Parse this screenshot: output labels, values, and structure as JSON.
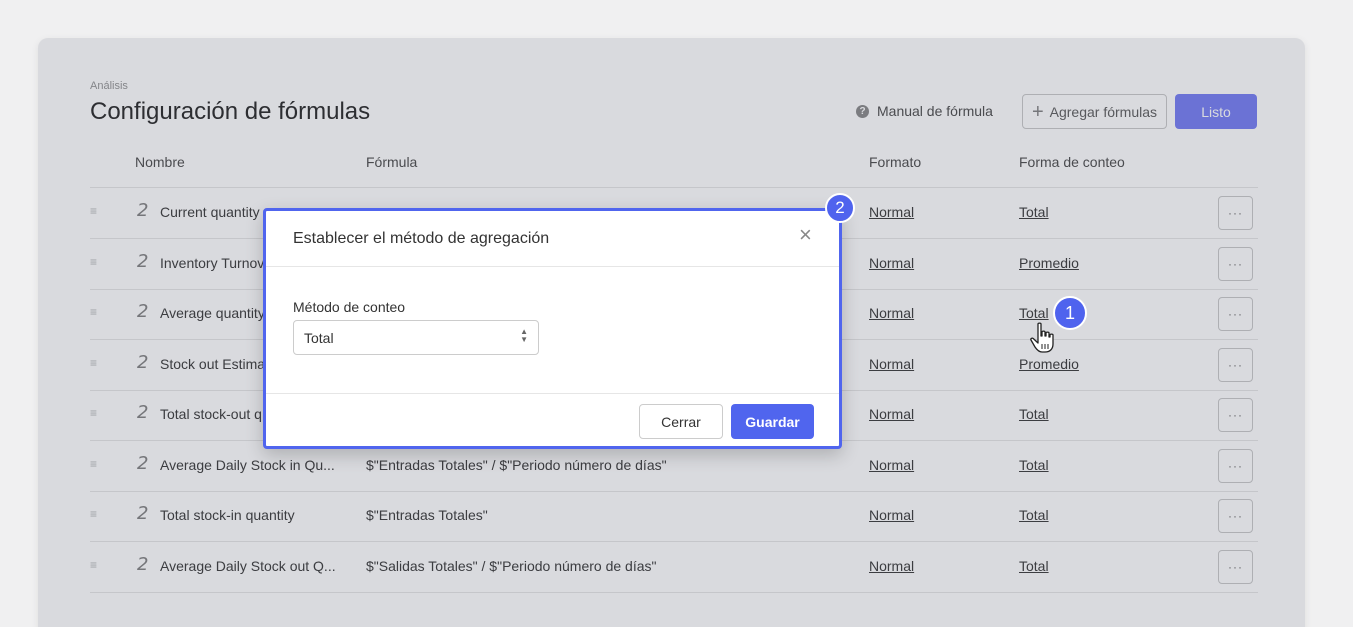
{
  "header": {
    "breadcrumb": "Análisis",
    "title": "Configuración de fórmulas",
    "manual_label": "Manual de fórmula",
    "add_label": "Agregar fórmulas",
    "done_label": "Listo"
  },
  "table": {
    "columns": [
      "Nombre",
      "Fórmula",
      "Formato",
      "Forma de conteo"
    ],
    "rows": [
      {
        "name": "Current quantity",
        "formula": "",
        "format": "Normal",
        "count": "Total"
      },
      {
        "name": "Inventory Turnover",
        "formula": "",
        "format": "Normal",
        "count": "Promedio"
      },
      {
        "name": "Average quantity",
        "formula": "",
        "format": "Normal",
        "count": "Total"
      },
      {
        "name": "Stock out Estimate",
        "formula": "",
        "format": "Normal",
        "count": "Promedio"
      },
      {
        "name": "Total stock-out q",
        "formula": "",
        "format": "Normal",
        "count": "Total"
      },
      {
        "name": "Average Daily Stock in Qu...",
        "formula": "$\"Entradas Totales\" / $\"Periodo número de días\"",
        "format": "Normal",
        "count": "Total"
      },
      {
        "name": "Total stock-in quantity",
        "formula": "$\"Entradas Totales\"",
        "format": "Normal",
        "count": "Total"
      },
      {
        "name": "Average Daily Stock out Q...",
        "formula": "$\"Salidas Totales\" / $\"Periodo número de días\"",
        "format": "Normal",
        "count": "Total"
      }
    ],
    "more_label": "···",
    "drag_glyph": "≡",
    "fx_glyph": "2"
  },
  "modal": {
    "title": "Establecer el método de agregación",
    "field_label": "Método de conteo",
    "selected": "Total",
    "cancel_label": "Cerrar",
    "save_label": "Guardar"
  },
  "annotations": {
    "badge1": "1",
    "badge2": "2"
  },
  "colors": {
    "accent": "#5065ee",
    "done_button": "#7c84f5"
  },
  "icons": [
    "help-icon",
    "plus-icon",
    "drag-handle-icon",
    "formula-icon",
    "more-icon",
    "close-icon",
    "select-arrows-icon",
    "hand-cursor-icon"
  ]
}
